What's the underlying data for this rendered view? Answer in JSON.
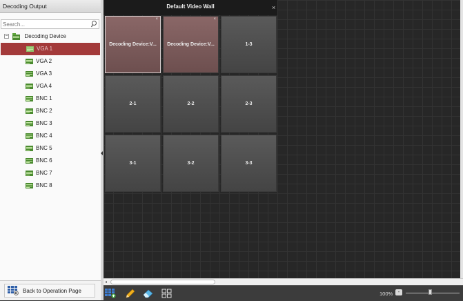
{
  "left_panel": {
    "title": "Decoding Output",
    "search_placeholder": "Search...",
    "root_label": "Decoding Device",
    "items": [
      {
        "label": "VGA 1",
        "selected": true
      },
      {
        "label": "VGA 2"
      },
      {
        "label": "VGA 3"
      },
      {
        "label": "VGA 4"
      },
      {
        "label": "BNC 1"
      },
      {
        "label": "BNC 2"
      },
      {
        "label": "BNC 3"
      },
      {
        "label": "BNC 4"
      },
      {
        "label": "BNC 5"
      },
      {
        "label": "BNC 6"
      },
      {
        "label": "BNC 7"
      },
      {
        "label": "BNC 8"
      }
    ],
    "back_label": "Back to Operation Page"
  },
  "wall": {
    "title": "Default Video Wall",
    "close_glyph": "×",
    "tiles": [
      {
        "label": "Decoding Device:V...",
        "active": true
      },
      {
        "label": "Decoding Device:V...",
        "active": true
      },
      {
        "label": "1-3"
      },
      {
        "label": "2-1"
      },
      {
        "label": "2-2"
      },
      {
        "label": "2-3"
      },
      {
        "label": "3-1"
      },
      {
        "label": "3-2"
      },
      {
        "label": "3-3"
      }
    ],
    "tile_close_glyph": "×"
  },
  "toolbar": {
    "zoom_label": "100%",
    "zoom_minus": "-",
    "zoom_level": 0.45
  },
  "colors": {
    "selected_row": "#a33a3a",
    "active_tile": "#8a6767",
    "wall_background": "#272727"
  },
  "icons": [
    "search-icon",
    "device-folder-icon",
    "monitor-output-icon",
    "back-grid-icon",
    "layout-grid-icon",
    "pencil-icon",
    "eraser-icon",
    "window-split-icon"
  ]
}
